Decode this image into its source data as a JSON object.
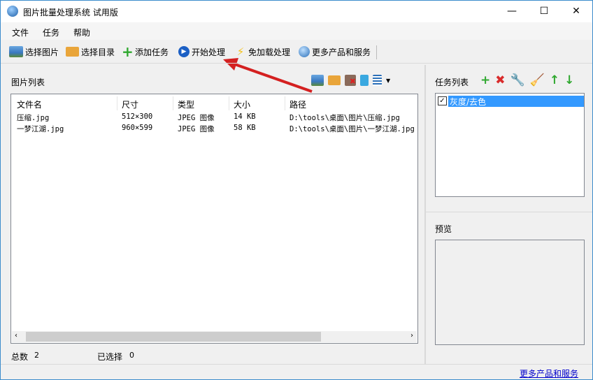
{
  "window": {
    "title": "图片批量处理系统 试用版",
    "minimize": "—",
    "maximize": "☐",
    "close": "✕"
  },
  "menu": [
    "文件",
    "任务",
    "帮助"
  ],
  "toolbar": [
    {
      "label": "选择图片",
      "icon": "image-icon",
      "color": "#3a78c0"
    },
    {
      "label": "选择目录",
      "icon": "folder-icon",
      "color": "#e9a53a"
    },
    {
      "label": "添加任务",
      "icon": "plus-icon",
      "color": "#2fa82f"
    },
    {
      "label": "开始处理",
      "icon": "play-icon",
      "color": "#1b5fc4"
    },
    {
      "label": "免加载处理",
      "icon": "lightning-icon",
      "color": "#f4c21a"
    },
    {
      "label": "更多产品和服务",
      "icon": "globe-icon",
      "color": "#2a6fb8"
    }
  ],
  "image_panel": {
    "title": "图片列表",
    "columns": [
      "文件名",
      "尺寸",
      "类型",
      "大小",
      "路径"
    ],
    "rows": [
      [
        "压缩.jpg",
        "512×300",
        "JPEG 图像",
        "14 KB",
        "D:\\tools\\桌面\\图片\\压缩.jpg"
      ],
      [
        "一梦江湖.jpg",
        "960×599",
        "JPEG 图像",
        "58 KB",
        "D:\\tools\\桌面\\图片\\一梦江湖.jpg"
      ]
    ]
  },
  "status": {
    "total_label": "总数",
    "total": "2",
    "selected_label": "已选择",
    "selected": "0"
  },
  "task_panel": {
    "title": "任务列表",
    "items": [
      {
        "label": "灰度/去色",
        "checked": true
      }
    ]
  },
  "preview": {
    "title": "预览"
  },
  "footer_link": "更多产品和服务"
}
